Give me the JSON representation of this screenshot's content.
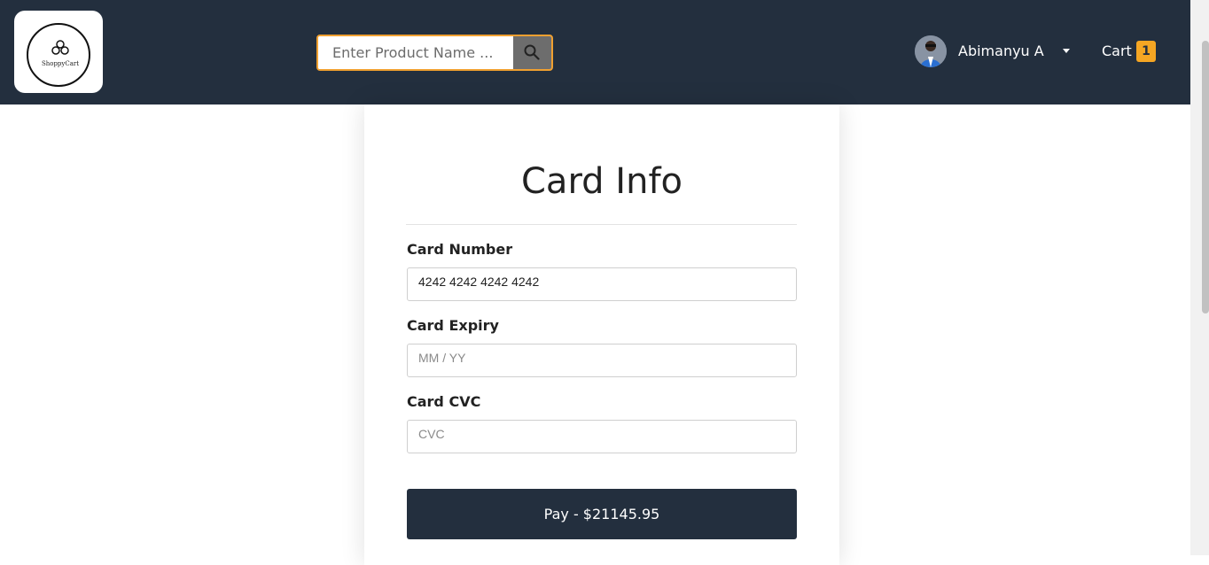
{
  "header": {
    "logo_text": "ShoppyCart",
    "search": {
      "placeholder": "Enter Product Name ...",
      "value": ""
    },
    "user": {
      "name": "Abimanyu A"
    },
    "cart": {
      "label": "Cart",
      "count": "1"
    }
  },
  "card_form": {
    "title": "Card Info",
    "card_number": {
      "label": "Card Number",
      "value": "4242 4242 4242 4242",
      "placeholder": ""
    },
    "card_expiry": {
      "label": "Card Expiry",
      "value": "",
      "placeholder": "MM / YY"
    },
    "card_cvc": {
      "label": "Card CVC",
      "value": "",
      "placeholder": "CVC"
    },
    "pay_button": "Pay - $21145.95"
  },
  "colors": {
    "navbar": "#232f3e",
    "accent": "#f5a623",
    "pay_button": "#232f3e"
  }
}
